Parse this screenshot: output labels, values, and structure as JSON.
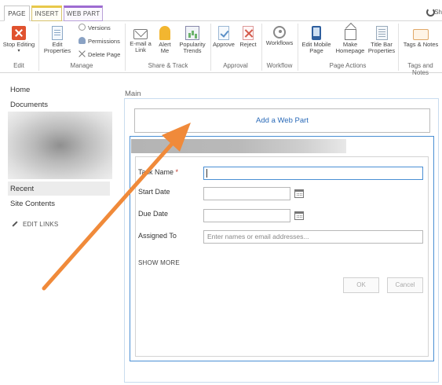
{
  "tabs": [
    {
      "label": "PAGE"
    },
    {
      "label": "INSERT"
    },
    {
      "label": "WEB PART"
    }
  ],
  "share_label": "Sh",
  "ribbon": {
    "edit": {
      "stop_editing": "Stop Editing",
      "group": "Edit"
    },
    "manage": {
      "edit_properties": "Edit Properties",
      "versions": "Versions",
      "permissions": "Permissions",
      "delete_page": "Delete Page",
      "group": "Manage"
    },
    "share_track": {
      "email_link": "E-mail a Link",
      "alert_me": "Alert Me",
      "popularity_trends": "Popularity Trends",
      "group": "Share & Track"
    },
    "approval": {
      "approve": "Approve",
      "reject": "Reject",
      "group": "Approval"
    },
    "workflow": {
      "workflows": "Workflows",
      "group": "Workflow"
    },
    "page_actions": {
      "edit_mobile_page": "Edit Mobile Page",
      "make_homepage": "Make Homepage",
      "title_bar_properties": "Title Bar Properties",
      "group": "Page Actions"
    },
    "tags_notes": {
      "tags_notes": "Tags & Notes",
      "group": "Tags and Notes"
    }
  },
  "nav": {
    "home": "Home",
    "documents": "Documents",
    "recent": "Recent",
    "site_contents": "Site Contents",
    "edit_links": "EDIT LINKS"
  },
  "main": {
    "zone_label": "Main",
    "add_web_part": "Add a Web Part"
  },
  "form": {
    "task_name_label": "Task Name",
    "required_mark": "*",
    "start_date_label": "Start Date",
    "due_date_label": "Due Date",
    "assigned_to_label": "Assigned To",
    "assigned_to_placeholder": "Enter names or email addresses...",
    "show_more": "SHOW MORE",
    "ok": "OK",
    "cancel": "Cancel"
  },
  "colors": {
    "link_blue": "#2a6ab8",
    "webpart_border": "#4a8fd4",
    "annotation_arrow": "#f08a3a",
    "stop_editing_red": "#e0522f"
  }
}
